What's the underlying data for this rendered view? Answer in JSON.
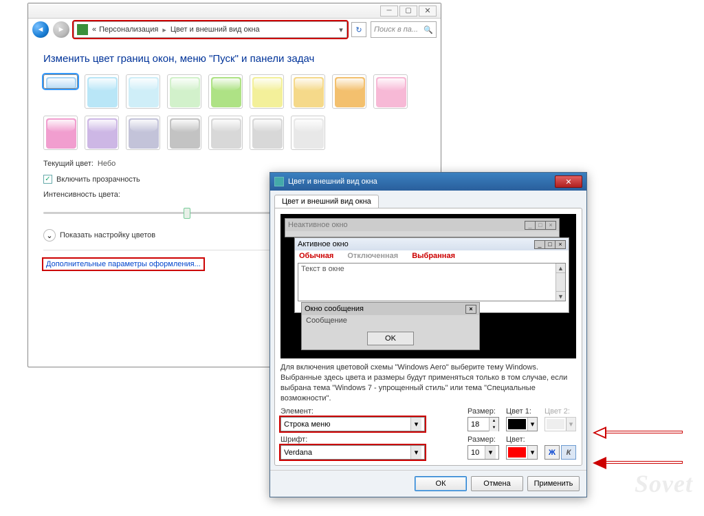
{
  "win1": {
    "breadcrumb": {
      "prefix": "«",
      "a": "Персонализация",
      "b": "Цвет и внешний вид окна"
    },
    "search_placeholder": "Поиск в па...",
    "heading": "Изменить цвет границ окон, меню \"Пуск\" и панели задач",
    "swatches": [
      "#a9d4f5",
      "#b9e6f7",
      "#cfeef8",
      "#d2f1cb",
      "#aee285",
      "#f3f09a",
      "#f5d98a",
      "#f3c06e",
      "#f7b9d6",
      "#f19ecf",
      "#cdb7e5",
      "#c3c3d9",
      "#c3c3c3",
      "#d8d8d8",
      "#d8d8d8",
      "#e8e8e8"
    ],
    "current_label": "Текущий цвет:",
    "current_val": "Небо",
    "transparency": "Включить прозрачность",
    "intensity": "Интенсивность цвета:",
    "show_mixer": "Показать настройку цветов",
    "advanced_link": "Дополнительные параметры оформления..."
  },
  "win2": {
    "title": "Цвет и внешний вид окна",
    "tab": "Цвет и внешний вид окна",
    "preview": {
      "inactive": "Неактивное окно",
      "active": "Активное окно",
      "menu": {
        "m1": "Обычная",
        "m2": "Отключенная",
        "m3": "Выбранная"
      },
      "textbox": "Текст в окне",
      "msg_title": "Окно сообщения",
      "msg_body": "Сообщение",
      "ok": "OK"
    },
    "note": "Для включения цветовой схемы \"Windows Aero\" выберите тему Windows. Выбранные здесь цвета и размеры будут применяться только в том случае, если выбрана тема \"Windows 7 - упрощенный стиль\" или тема \"Специальные возможности\".",
    "labels": {
      "element": "Элемент:",
      "size": "Размер:",
      "color1": "Цвет 1:",
      "color2": "Цвет 2:",
      "font": "Шрифт:",
      "color": "Цвет:"
    },
    "element_value": "Строка меню",
    "element_size": "18",
    "element_color1": "#000000",
    "font_value": "Verdana",
    "font_size": "10",
    "font_color": "#ff0000",
    "bold": "Ж",
    "italic": "К",
    "buttons": {
      "ok": "ОК",
      "cancel": "Отмена",
      "apply": "Применить"
    }
  },
  "watermark": "Sovet"
}
